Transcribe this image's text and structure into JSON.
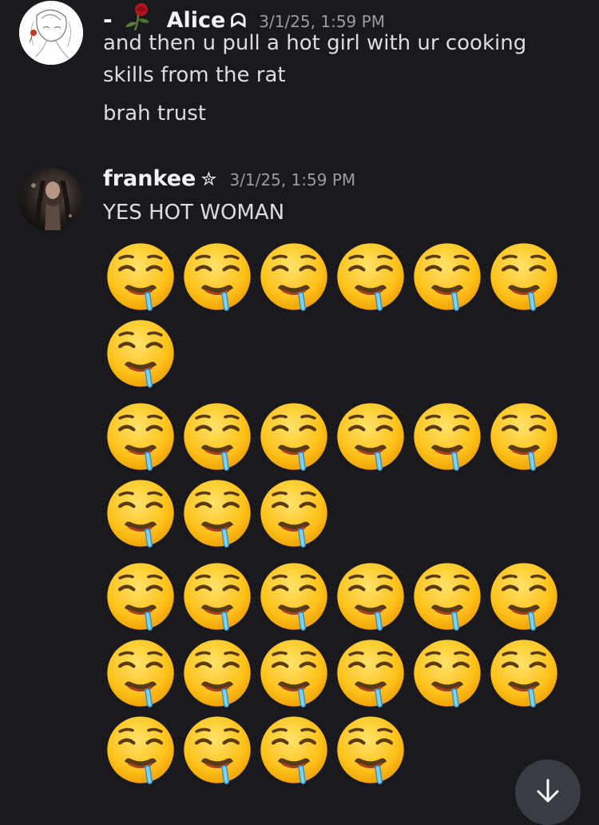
{
  "messages": [
    {
      "author": "Alice",
      "author_prefix": "-",
      "name_decoration": "ᗣ",
      "timestamp": "3/1/25, 1:59 PM",
      "lines": [
        "and then u pull a hot girl with ur cooking skills from the rat",
        "brah trust"
      ]
    },
    {
      "author": "frankee",
      "name_decoration": "✮",
      "timestamp": "3/1/25, 1:59 PM",
      "text": "YES HOT WOMAN",
      "emoji_name": "drooling-face",
      "emoji_block_counts": [
        7,
        9,
        16
      ]
    }
  ],
  "colors": {
    "background": "#1a1a1e",
    "username": "#f2f3f5",
    "message_text": "#dbdee1",
    "timestamp": "#9a9ca4",
    "scroll_button": "#3a3c43"
  },
  "icons": {
    "scroll_down": "arrow-down-icon"
  }
}
